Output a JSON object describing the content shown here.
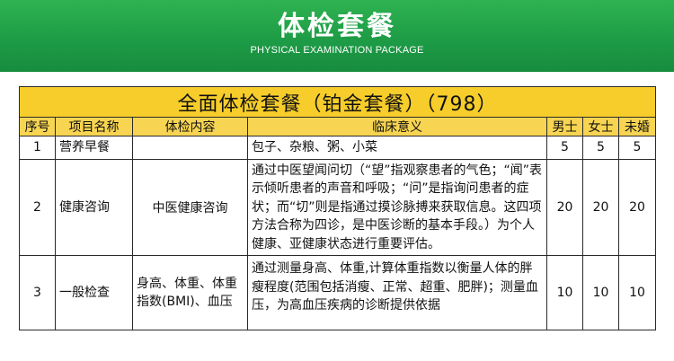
{
  "banner": {
    "title": "体检套餐",
    "subtitle": "PHYSICAL EXAMINATION PACKAGE"
  },
  "table": {
    "package_title": "全面体检套餐（铂金套餐）（798）",
    "columns": [
      "序号",
      "项目名称",
      "体检内容",
      "临床意义",
      "男士",
      "女士",
      "未婚"
    ],
    "rows": [
      {
        "no": "1",
        "item": "营养早餐",
        "content": "",
        "meaning": "包子、杂粮、粥、小菜",
        "male": "5",
        "female": "5",
        "unmarried": "5"
      },
      {
        "no": "2",
        "item": "健康咨询",
        "content": "中医健康咨询",
        "meaning": "通过中医望闻问切（“望”指观察患者的气色；“闻”表示倾听患者的声音和呼吸；“问”是指询问患者的症状；而“切”则是指通过摸诊脉搏来获取信息。这四项方法合称为四诊，是中医诊断的基本手段。）为个人健康、亚健康状态进行重要评估。",
        "male": "20",
        "female": "20",
        "unmarried": "20"
      },
      {
        "no": "3",
        "item": "一般检查",
        "content": "身高、体重、体重指数(BMI)、血压",
        "meaning": "通过测量身高、体重,计算体重指数以衡量人体的胖瘦程度(范围包括消瘦、正常、超重、肥胖)；测量血压，为高血压疾病的诊断提供依据",
        "male": "10",
        "female": "10",
        "unmarried": "10"
      }
    ]
  },
  "colors": {
    "banner_green": "#1e9c46",
    "header_yellow": "#f6cd2a",
    "column_header_yellow": "#f7d451"
  }
}
